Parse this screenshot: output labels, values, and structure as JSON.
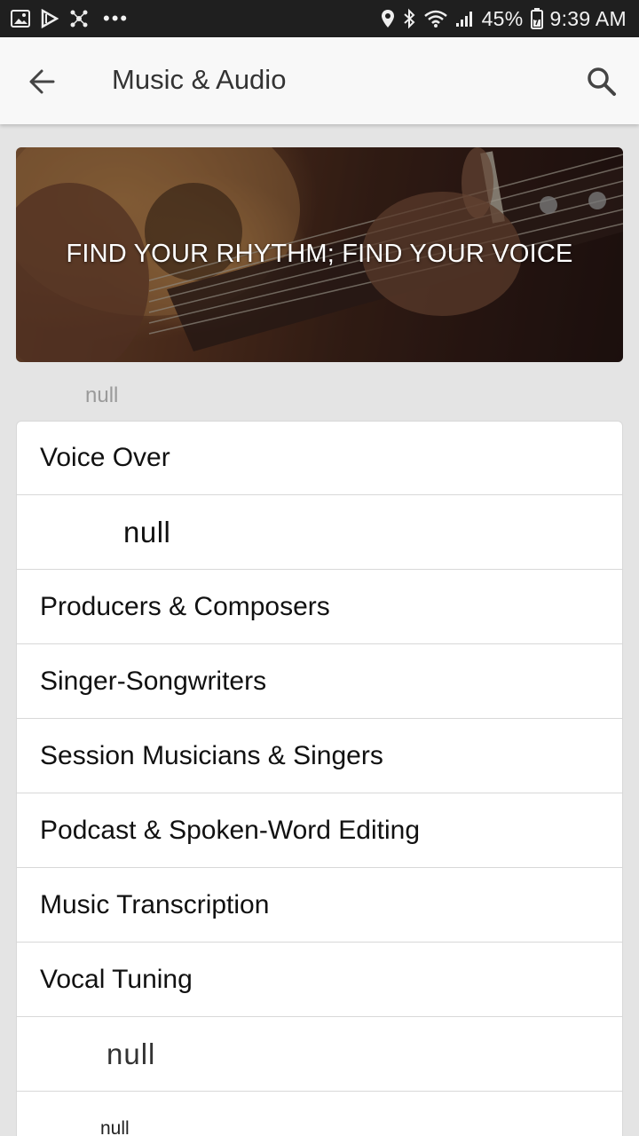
{
  "status_bar": {
    "battery": "45%",
    "time": "9:39 AM",
    "dots": "•••",
    "left_icons": [
      "gallery-icon",
      "download-icon",
      "hub-icon"
    ],
    "right_icons": [
      "location-icon",
      "bluetooth-icon",
      "wifi-icon",
      "signal-icon",
      "battery-icon"
    ]
  },
  "app_bar": {
    "title": "Music & Audio",
    "back_icon": "back-arrow-icon",
    "search_icon": "search-icon"
  },
  "hero": {
    "headline": "FIND YOUR RHYTHM; FIND YOUR VOICE"
  },
  "section_label": "null",
  "items": [
    {
      "label": "Voice Over"
    },
    {
      "label": "null"
    },
    {
      "label": "Producers & Composers"
    },
    {
      "label": "Singer-Songwriters"
    },
    {
      "label": "Session Musicians & Singers"
    },
    {
      "label": "Podcast & Spoken-Word Editing"
    },
    {
      "label": "Music Transcription"
    },
    {
      "label": "Vocal Tuning"
    },
    {
      "label": "null"
    },
    {
      "label": "null"
    }
  ],
  "colors": {
    "status_bar_bg": "#1f1f1f",
    "app_bar_bg": "#f8f8f8",
    "page_bg": "#e4e4e4"
  }
}
